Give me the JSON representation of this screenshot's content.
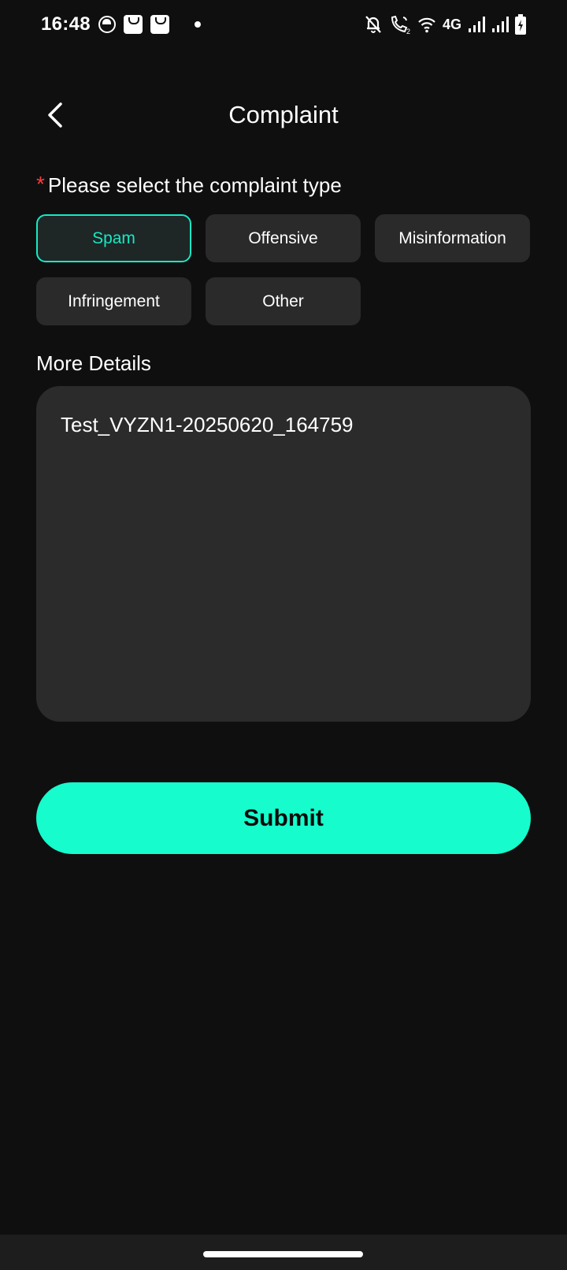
{
  "status_bar": {
    "time": "16:48",
    "network_label": "4G",
    "icons": [
      "face-icon",
      "bag-icon",
      "bag-icon",
      "dot-icon",
      "bell-off-icon",
      "wifi-call-icon",
      "wifi-icon",
      "signal-icon",
      "signal-icon",
      "battery-charging-icon"
    ]
  },
  "header": {
    "title": "Complaint",
    "back_icon": "chevron-left-icon"
  },
  "complaint_type": {
    "required_mark": "*",
    "label": "Please select the complaint type",
    "options": [
      {
        "label": "Spam",
        "selected": true
      },
      {
        "label": "Offensive",
        "selected": false
      },
      {
        "label": "Misinformation",
        "selected": false
      },
      {
        "label": "Infringement",
        "selected": false
      },
      {
        "label": "Other",
        "selected": false
      }
    ]
  },
  "details": {
    "label": "More Details",
    "value": "Test_VYZN1-20250620_164759"
  },
  "submit": {
    "label": "Submit"
  },
  "colors": {
    "background": "#0f0f0f",
    "accent": "#16fccd",
    "selected_border": "#16e9c4",
    "required": "#ff3b3b",
    "option_bg": "#2a2a2a"
  }
}
